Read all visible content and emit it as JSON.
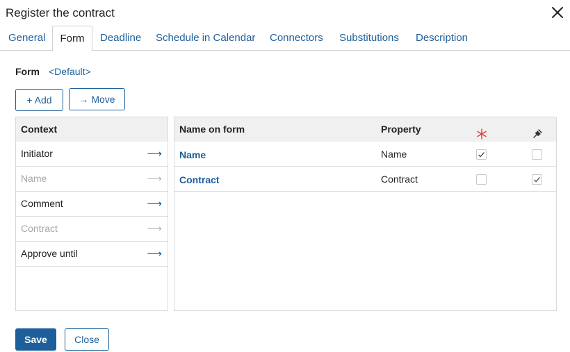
{
  "dialog": {
    "title": "Register the contract"
  },
  "tabs": [
    {
      "label": "General"
    },
    {
      "label": "Form"
    },
    {
      "label": "Deadline"
    },
    {
      "label": "Schedule in Calendar"
    },
    {
      "label": "Connectors"
    },
    {
      "label": "Substitutions"
    },
    {
      "label": "Description"
    }
  ],
  "active_tab": "Form",
  "form": {
    "label": "Form",
    "value": "<Default>"
  },
  "toolbar": {
    "add_label": "+ Add",
    "move_label": "→ Move"
  },
  "context": {
    "header": "Context",
    "items": [
      {
        "label": "Initiator",
        "enabled": true
      },
      {
        "label": "Name",
        "enabled": false
      },
      {
        "label": "Comment",
        "enabled": true
      },
      {
        "label": "Contract",
        "enabled": false
      },
      {
        "label": "Approve until",
        "enabled": true
      }
    ]
  },
  "form_fields": {
    "headers": {
      "name": "Name on form",
      "property": "Property",
      "required_icon": "asterisk-icon",
      "readonly_icon": "pin-icon"
    },
    "rows": [
      {
        "name": "Name",
        "property": "Name",
        "required": true,
        "readonly": false
      },
      {
        "name": "Contract",
        "property": "Contract",
        "required": false,
        "readonly": true
      }
    ]
  },
  "footer": {
    "save_label": "Save",
    "close_label": "Close"
  },
  "colors": {
    "accent": "#1d5f9a",
    "required": "#e53935",
    "header_bg": "#f0f0f0",
    "border": "#d9d9d9"
  }
}
